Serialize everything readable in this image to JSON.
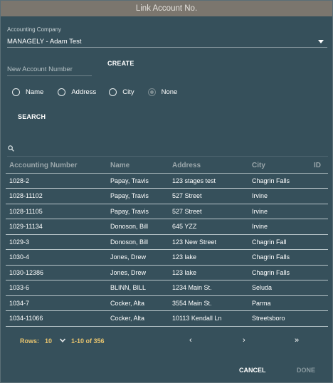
{
  "dialog": {
    "title": "Link Account No."
  },
  "company": {
    "label": "Accounting Company",
    "selected": "MANAGELY - Adam Test"
  },
  "account_input": {
    "placeholder": "New Account Number",
    "value": ""
  },
  "buttons": {
    "create": "CREATE",
    "search": "SEARCH",
    "cancel": "CANCEL",
    "done": "DONE"
  },
  "radios": [
    {
      "label": "Name",
      "state": "unchecked"
    },
    {
      "label": "Address",
      "state": "unchecked"
    },
    {
      "label": "City",
      "state": "unchecked"
    },
    {
      "label": "None",
      "state": "disabled-selected"
    }
  ],
  "table": {
    "columns": [
      "Accounting Number",
      "Name",
      "Address",
      "City",
      "ID"
    ],
    "rows": [
      [
        "1028-2",
        "Papay, Travis",
        "123 stages test",
        "Chagrin Falls",
        ""
      ],
      [
        "1028-11102",
        "Papay, Travis",
        "527 Street",
        "Irvine",
        ""
      ],
      [
        "1028-11105",
        "Papay, Travis",
        "527 Street",
        "Irvine",
        ""
      ],
      [
        "1029-11134",
        "Donoson, Bill",
        "645 YZZ",
        "Irvine",
        ""
      ],
      [
        "1029-3",
        "Donoson, Bill",
        "123 New Street",
        "Chagrin Fall",
        ""
      ],
      [
        "1030-4",
        "Jones, Drew",
        "123 lake",
        "Chagrin Falls",
        ""
      ],
      [
        "1030-12386",
        "Jones, Drew",
        "123 lake",
        "Chagrin Falls",
        ""
      ],
      [
        "1033-6",
        "BLINN, BILL",
        "1234 Main St.",
        "Seluda",
        ""
      ],
      [
        "1034-7",
        "Cocker, Alta",
        "3554 Main St.",
        "Parma",
        ""
      ],
      [
        "1034-11066",
        "Cocker, Alta",
        "10113 Kendall Ln",
        "Streetsboro",
        ""
      ]
    ]
  },
  "pagination": {
    "rows_label": "Rows:",
    "rows_value": "10",
    "range": "1-10 of 356",
    "prev": "‹",
    "next": "›",
    "last": "»"
  },
  "colors": {
    "background": "#36505b",
    "titlebar": "#7b766e",
    "accent": "#e8c46e"
  },
  "icons": [
    "chevron-down-icon",
    "search-icon"
  ]
}
